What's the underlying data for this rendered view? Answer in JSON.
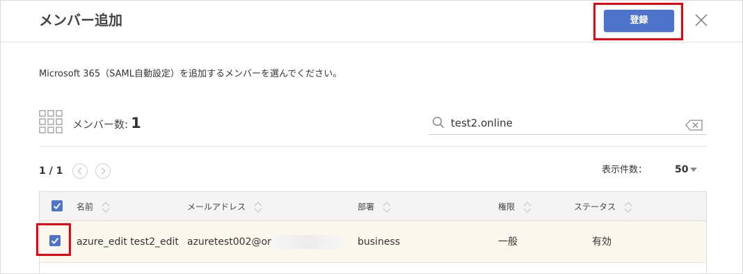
{
  "dialog": {
    "title": "メンバー追加",
    "register_label": "登録",
    "description": "Microsoft 365（SAML自動設定）を追加するメンバーを選んでください。"
  },
  "member_count": {
    "label": "メンバー数:",
    "value": "1"
  },
  "search": {
    "value": "test2.online",
    "placeholder": ""
  },
  "pagination": {
    "text": "1 / 1"
  },
  "per_page": {
    "label": "表示件数：",
    "value": "50"
  },
  "table": {
    "columns": [
      "名前",
      "メールアドレス",
      "部署",
      "権限",
      "ステータス"
    ],
    "header_checked": true,
    "rows": [
      {
        "checked": true,
        "name": "azure_edit test2_edit",
        "email": "azuretest002@only",
        "department": "business",
        "role": "一般",
        "status": "有効"
      }
    ]
  },
  "colors": {
    "accent": "#4e74c9",
    "highlight": "#e60012",
    "row_selected": "#fbf7ec"
  },
  "icons": [
    "close-icon",
    "grid-icon",
    "search-icon",
    "clear-icon",
    "chevron-left-icon",
    "chevron-right-icon",
    "sort-icon",
    "check-icon",
    "caret-down-icon"
  ]
}
